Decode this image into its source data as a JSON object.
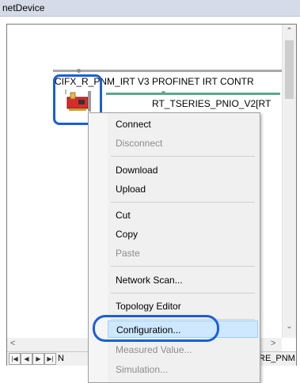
{
  "window": {
    "title": "netDevice"
  },
  "canvas": {
    "device_label": "CIFX_RE_PNM_IRT V3 PROFINET IRT CONTR",
    "device_label_prefix": "CIFX_R",
    "device_label_suffix": "_PNM_IRT V3 PROFINET IRT CONTR",
    "slave_label": "RT_TSERIES_PNIO_V2[RT"
  },
  "menu": {
    "items": [
      {
        "label": "Connect",
        "enabled": true
      },
      {
        "label": "Disconnect",
        "enabled": false
      },
      {
        "label": "Download",
        "enabled": true
      },
      {
        "label": "Upload",
        "enabled": true
      },
      {
        "label": "Cut",
        "enabled": true
      },
      {
        "label": "Copy",
        "enabled": true
      },
      {
        "label": "Paste",
        "enabled": false
      },
      {
        "label": "Network Scan...",
        "enabled": true
      },
      {
        "label": "Topology Editor",
        "enabled": true
      },
      {
        "label": "Configuration...",
        "enabled": true,
        "selected": true
      },
      {
        "label": "Measured Value...",
        "enabled": false
      },
      {
        "label": "Simulation...",
        "enabled": false
      }
    ]
  },
  "bottom": {
    "tab_left": "N",
    "tab_right": "RE_PNM"
  },
  "colors": {
    "highlight": "#1a5fd6",
    "bus_green": "#5aa88f",
    "menu_bg": "#f0f0f0",
    "selected_bg": "#cde8ff"
  }
}
